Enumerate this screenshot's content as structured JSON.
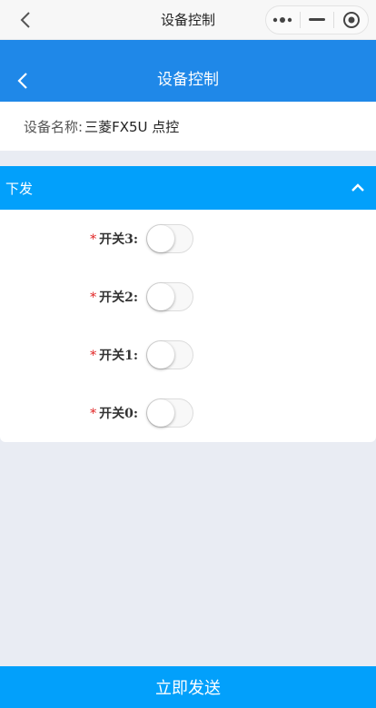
{
  "system_bar": {
    "title": "设备控制",
    "back_icon": "chevron-left-icon",
    "capsule": {
      "more_icon": "more-dots-icon",
      "minimize_icon": "minus-icon",
      "close_icon": "target-circle-icon"
    }
  },
  "header": {
    "title": "设备控制",
    "back_icon": "chevron-left-icon",
    "color": "#1f88e8"
  },
  "device": {
    "label": "设备名称:",
    "value": "三菱FX5U 点控"
  },
  "section": {
    "title": "下发",
    "toggle_icon": "chevron-up-icon",
    "color": "#02a0fb"
  },
  "switches": [
    {
      "required_mark": "*",
      "label": "开关3:",
      "on": false
    },
    {
      "required_mark": "*",
      "label": "开关2:",
      "on": false
    },
    {
      "required_mark": "*",
      "label": "开关1:",
      "on": false
    },
    {
      "required_mark": "*",
      "label": "开关0:",
      "on": false
    }
  ],
  "footer": {
    "send_label": "立即发送"
  }
}
